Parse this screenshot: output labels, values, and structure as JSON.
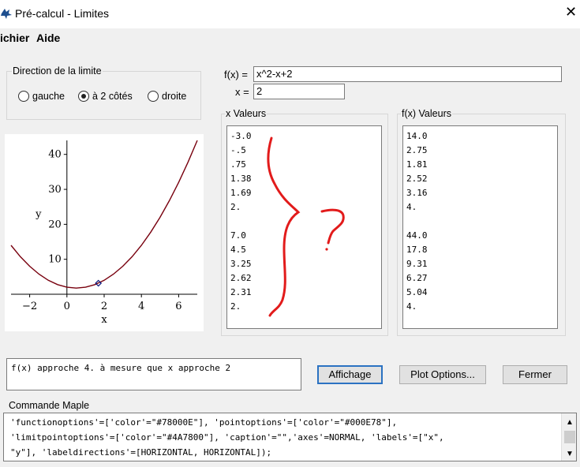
{
  "window": {
    "title": "Pré-calcul - Limites",
    "app_icon": "maple-leaf-icon",
    "close_icon": "close-icon"
  },
  "menu": {
    "items": [
      "ichier",
      "Aide"
    ]
  },
  "direction": {
    "label": "Direction de la limite",
    "options": [
      "gauche",
      "à 2 côtés",
      "droite"
    ],
    "selected": "à 2 côtés"
  },
  "inputs": {
    "fx_label": "f(x) =",
    "fx_value": "x^2-x+2",
    "x_label": "x =",
    "x_value": "2"
  },
  "plot": {
    "x_ticks": [
      "−2",
      "0",
      "2",
      "4",
      "6"
    ],
    "y_ticks": [
      "10",
      "20",
      "30",
      "40"
    ],
    "x_label": "x",
    "y_label": "y",
    "function_color": "#78000E",
    "point_color": "#000E78",
    "limitpoint_color": "#4A7800"
  },
  "chart_data": {
    "type": "line",
    "x": [
      -3,
      -2.5,
      -2,
      -1.5,
      -1,
      -0.5,
      0,
      0.5,
      1,
      1.5,
      2,
      2.5,
      3,
      3.5,
      4,
      4.5,
      5,
      5.5,
      6,
      6.5,
      7
    ],
    "y": [
      14,
      10.75,
      8,
      5.75,
      4,
      2.75,
      2,
      1.75,
      2,
      2.75,
      4,
      5.75,
      8,
      10.75,
      14,
      17.75,
      22,
      26.75,
      32,
      37.75,
      44
    ],
    "points": [
      {
        "x": 1.69,
        "y": 3.16
      }
    ],
    "xlabel": "x",
    "ylabel": "y",
    "xlim": [
      -3,
      7
    ],
    "ylim": [
      0,
      44
    ]
  },
  "x_values": {
    "label": "x Valeurs",
    "items": [
      "-3.0",
      "-.5",
      ".75",
      "1.38",
      "1.69",
      "2.",
      "",
      "7.0",
      "4.5",
      "3.25",
      "2.62",
      "2.31",
      "2."
    ]
  },
  "fx_values": {
    "label": "f(x) Valeurs",
    "items": [
      "14.0",
      "2.75",
      "1.81",
      "2.52",
      "3.16",
      "4.",
      "",
      "44.0",
      "17.8",
      "9.31",
      "6.27",
      "5.04",
      "4."
    ]
  },
  "result_text": "f(x) approche 4. à mesure que x approche 2",
  "buttons": {
    "display": "Affichage",
    "plot_options": "Plot Options...",
    "close": "Fermer"
  },
  "maple_command": {
    "label": "Commande Maple",
    "lines": [
      "'functionoptions'=['color'=\"#78000E\"], 'pointoptions'=['color'=\"#000E78\"],",
      "'limitpointoptions'=['color'=\"#4A7800\"], 'caption'=\"\",'axes'=NORMAL, 'labels'=[\"x\",",
      "\"y\"], 'labeldirections'=[HORIZONTAL, HORIZONTAL]);"
    ]
  },
  "annotation_color": "#e21b1b"
}
